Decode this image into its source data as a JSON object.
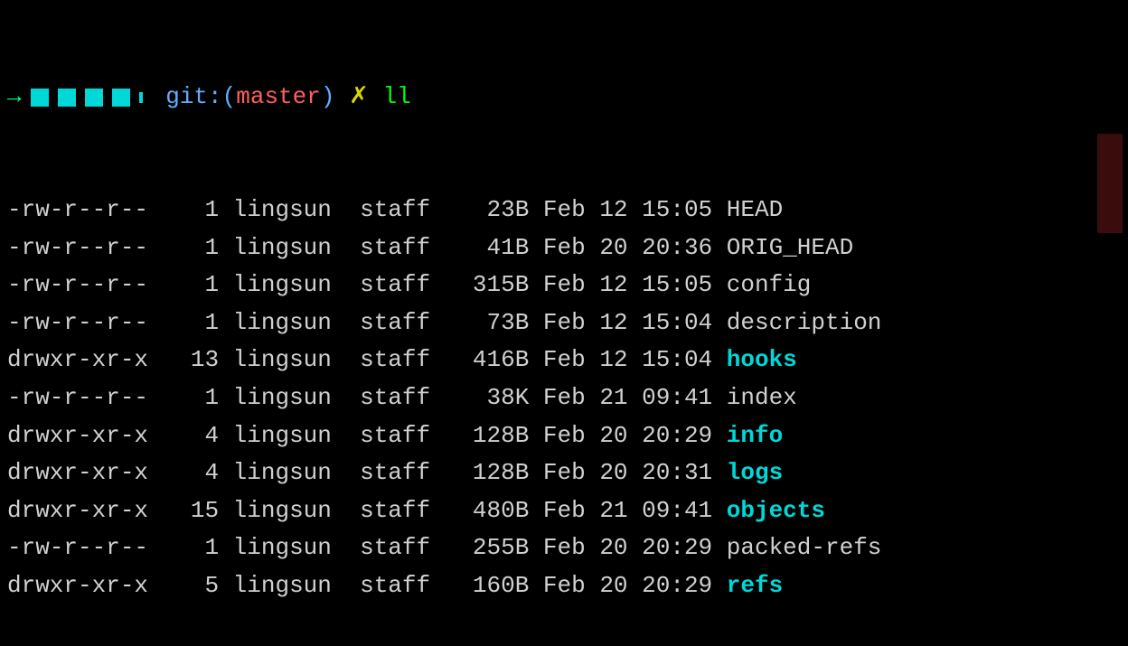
{
  "prompt": {
    "arrow": "→",
    "git_label": "git:",
    "branch": "master",
    "flag": "✗",
    "command": "ll"
  },
  "listing": {
    "owner": "lingsun",
    "group": "staff",
    "rows": [
      {
        "perms": "-rw-r--r--",
        "links": "1",
        "size": "23B",
        "month": "Feb",
        "day": "12",
        "time": "15:05",
        "name": "HEAD",
        "is_dir": false
      },
      {
        "perms": "-rw-r--r--",
        "links": "1",
        "size": "41B",
        "month": "Feb",
        "day": "20",
        "time": "20:36",
        "name": "ORIG_HEAD",
        "is_dir": false
      },
      {
        "perms": "-rw-r--r--",
        "links": "1",
        "size": "315B",
        "month": "Feb",
        "day": "12",
        "time": "15:05",
        "name": "config",
        "is_dir": false
      },
      {
        "perms": "-rw-r--r--",
        "links": "1",
        "size": "73B",
        "month": "Feb",
        "day": "12",
        "time": "15:04",
        "name": "description",
        "is_dir": false
      },
      {
        "perms": "drwxr-xr-x",
        "links": "13",
        "size": "416B",
        "month": "Feb",
        "day": "12",
        "time": "15:04",
        "name": "hooks",
        "is_dir": true
      },
      {
        "perms": "-rw-r--r--",
        "links": "1",
        "size": "38K",
        "month": "Feb",
        "day": "21",
        "time": "09:41",
        "name": "index",
        "is_dir": false
      },
      {
        "perms": "drwxr-xr-x",
        "links": "4",
        "size": "128B",
        "month": "Feb",
        "day": "20",
        "time": "20:29",
        "name": "info",
        "is_dir": true
      },
      {
        "perms": "drwxr-xr-x",
        "links": "4",
        "size": "128B",
        "month": "Feb",
        "day": "20",
        "time": "20:31",
        "name": "logs",
        "is_dir": true
      },
      {
        "perms": "drwxr-xr-x",
        "links": "15",
        "size": "480B",
        "month": "Feb",
        "day": "21",
        "time": "09:41",
        "name": "objects",
        "is_dir": true
      },
      {
        "perms": "-rw-r--r--",
        "links": "1",
        "size": "255B",
        "month": "Feb",
        "day": "20",
        "time": "20:29",
        "name": "packed-refs",
        "is_dir": false
      },
      {
        "perms": "drwxr-xr-x",
        "links": "5",
        "size": "160B",
        "month": "Feb",
        "day": "20",
        "time": "20:29",
        "name": "refs",
        "is_dir": true
      }
    ]
  }
}
